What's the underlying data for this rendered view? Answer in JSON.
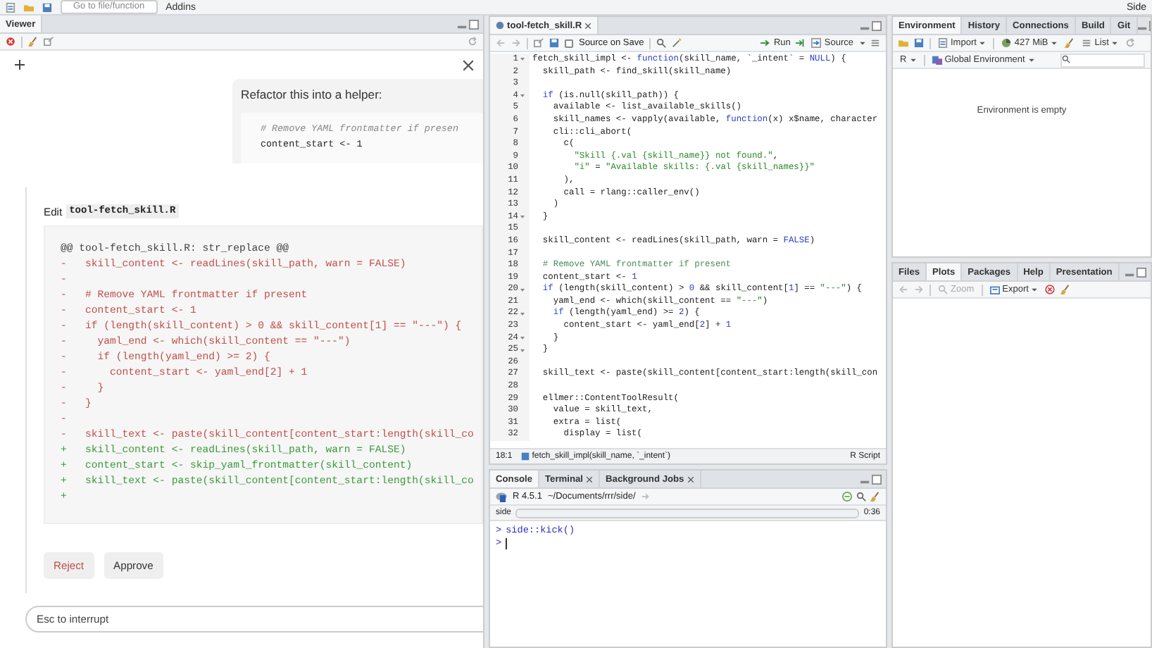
{
  "toolbar": {
    "goto_placeholder": "Go to file/function",
    "addins": "Addins",
    "project": "Side"
  },
  "viewer": {
    "tabs": [
      {
        "label": "Viewer",
        "selected": true
      }
    ],
    "prompt": {
      "title": "Refactor this into a helper:",
      "code": [
        "# Remove YAML frontmatter if presen",
        "content_start <- 1"
      ]
    },
    "edit": {
      "label": "Edit",
      "file": "tool-fetch_skill.R"
    },
    "diff": [
      {
        "kind": "header",
        "text": "@@ tool-fetch_skill.R: str_replace @@"
      },
      {
        "kind": "removed",
        "text": "-   skill_content <- readLines(skill_path, warn = FALSE)"
      },
      {
        "kind": "removed",
        "text": "-"
      },
      {
        "kind": "removed",
        "text": "-   # Remove YAML frontmatter if present"
      },
      {
        "kind": "removed",
        "text": "-   content_start <- 1"
      },
      {
        "kind": "removed",
        "text": "-   if (length(skill_content) > 0 && skill_content[1] == \"---\") {"
      },
      {
        "kind": "removed",
        "text": "-     yaml_end <- which(skill_content == \"---\")"
      },
      {
        "kind": "removed",
        "text": "-     if (length(yaml_end) >= 2) {"
      },
      {
        "kind": "removed",
        "text": "-       content_start <- yaml_end[2] + 1"
      },
      {
        "kind": "removed",
        "text": "-     }"
      },
      {
        "kind": "removed",
        "text": "-   }"
      },
      {
        "kind": "removed",
        "text": "-"
      },
      {
        "kind": "removed",
        "text": "-   skill_text <- paste(skill_content[content_start:length(skill_co"
      },
      {
        "kind": "added",
        "text": "+   skill_content <- readLines(skill_path, warn = FALSE)"
      },
      {
        "kind": "added",
        "text": "+   content_start <- skip_yaml_frontmatter(skill_content)"
      },
      {
        "kind": "added",
        "text": "+   skill_text <- paste(skill_content[content_start:length(skill_co"
      },
      {
        "kind": "added",
        "text": "+"
      }
    ],
    "buttons": [
      {
        "label": "Reject",
        "kind": "reject"
      },
      {
        "label": "Approve",
        "kind": "approve"
      }
    ],
    "input": {
      "placeholder": "Esc to interrupt"
    }
  },
  "editor": {
    "tabs": [
      {
        "label": "tool-fetch_skill.R",
        "selected": true
      }
    ],
    "source_on_save": {
      "label": "Source on Save",
      "checked": false
    },
    "run": "Run",
    "source": "Source",
    "lines": [
      {
        "n": "1",
        "fold": true,
        "parts": [
          {
            "kind": "id",
            "text": "fetch_skill_impl <- "
          },
          {
            "kind": "kw",
            "text": "function"
          },
          {
            "kind": "id",
            "text": "(skill_name, `_intent` = "
          },
          {
            "kind": "kw",
            "text": "NULL"
          },
          {
            "kind": "id",
            "text": ") {"
          }
        ]
      },
      {
        "n": "2",
        "fold": false,
        "parts": [
          {
            "kind": "id",
            "text": "  skill_path <- find_skill(skill_name)"
          }
        ]
      },
      {
        "n": "3",
        "fold": false
      },
      {
        "n": "4",
        "fold": true,
        "parts": [
          {
            "kind": "kw",
            "text": "  if"
          },
          {
            "kind": "id",
            "text": " (is.null(skill_path)) {"
          }
        ]
      },
      {
        "n": "5",
        "fold": false,
        "parts": [
          {
            "kind": "id",
            "text": "    available <- list_available_skills()"
          }
        ]
      },
      {
        "n": "6",
        "fold": false,
        "parts": [
          {
            "kind": "id",
            "text": "    skill_names <- vapply(available, "
          },
          {
            "kind": "kw",
            "text": "function"
          },
          {
            "kind": "id",
            "text": "(x) x$name, character"
          }
        ]
      },
      {
        "n": "7",
        "fold": false,
        "parts": [
          {
            "kind": "id",
            "text": "    cli::cli_abort("
          }
        ]
      },
      {
        "n": "8",
        "fold": false,
        "parts": [
          {
            "kind": "id",
            "text": "      c("
          }
        ]
      },
      {
        "n": "9",
        "fold": false,
        "parts": [
          {
            "kind": "str",
            "text": "        \"Skill {.val {skill_name}} not found.\""
          },
          {
            "kind": "id",
            "text": ","
          }
        ]
      },
      {
        "n": "10",
        "fold": false,
        "parts": [
          {
            "kind": "str",
            "text": "        \"i\""
          },
          {
            "kind": "id",
            "text": " = "
          },
          {
            "kind": "str",
            "text": "\"Available skills: {.val {skill_names}}\""
          }
        ]
      },
      {
        "n": "11",
        "fold": false,
        "parts": [
          {
            "kind": "id",
            "text": "      ),"
          }
        ]
      },
      {
        "n": "12",
        "fold": false,
        "parts": [
          {
            "kind": "id",
            "text": "      call = rlang::caller_env()"
          }
        ]
      },
      {
        "n": "13",
        "fold": false,
        "parts": [
          {
            "kind": "id",
            "text": "    )"
          }
        ]
      },
      {
        "n": "14",
        "fold": true,
        "parts": [
          {
            "kind": "id",
            "text": "  }"
          }
        ]
      },
      {
        "n": "15",
        "fold": false
      },
      {
        "n": "16",
        "fold": false,
        "parts": [
          {
            "kind": "id",
            "text": "  skill_content <- readLines(skill_path, warn = "
          },
          {
            "kind": "kw",
            "text": "FALSE"
          },
          {
            "kind": "id",
            "text": ")"
          }
        ]
      },
      {
        "n": "17",
        "fold": false
      },
      {
        "n": "18",
        "fold": false,
        "parts": [
          {
            "kind": "com",
            "text": "  # Remove YAML frontmatter if present"
          }
        ]
      },
      {
        "n": "19",
        "fold": false,
        "parts": [
          {
            "kind": "id",
            "text": "  content_start <- "
          },
          {
            "kind": "num",
            "text": "1"
          }
        ]
      },
      {
        "n": "20",
        "fold": true,
        "parts": [
          {
            "kind": "kw",
            "text": "  if"
          },
          {
            "kind": "id",
            "text": " (length(skill_content) > "
          },
          {
            "kind": "num",
            "text": "0"
          },
          {
            "kind": "id",
            "text": " && skill_content["
          },
          {
            "kind": "num",
            "text": "1"
          },
          {
            "kind": "id",
            "text": "] == "
          },
          {
            "kind": "str",
            "text": "\"---\""
          },
          {
            "kind": "id",
            "text": ") {"
          }
        ]
      },
      {
        "n": "21",
        "fold": false,
        "parts": [
          {
            "kind": "id",
            "text": "    yaml_end <- which(skill_content == "
          },
          {
            "kind": "str",
            "text": "\"---\""
          },
          {
            "kind": "id",
            "text": ")"
          }
        ]
      },
      {
        "n": "22",
        "fold": true,
        "parts": [
          {
            "kind": "kw",
            "text": "    if"
          },
          {
            "kind": "id",
            "text": " (length(yaml_end) >= "
          },
          {
            "kind": "num",
            "text": "2"
          },
          {
            "kind": "id",
            "text": ") {"
          }
        ]
      },
      {
        "n": "23",
        "fold": false,
        "parts": [
          {
            "kind": "id",
            "text": "      content_start <- yaml_end["
          },
          {
            "kind": "num",
            "text": "2"
          },
          {
            "kind": "id",
            "text": "] + "
          },
          {
            "kind": "num",
            "text": "1"
          }
        ]
      },
      {
        "n": "24",
        "fold": true,
        "parts": [
          {
            "kind": "id",
            "text": "    }"
          }
        ]
      },
      {
        "n": "25",
        "fold": true,
        "parts": [
          {
            "kind": "id",
            "text": "  }"
          }
        ]
      },
      {
        "n": "26",
        "fold": false
      },
      {
        "n": "27",
        "fold": false,
        "parts": [
          {
            "kind": "id",
            "text": "  skill_text <- paste(skill_content[content_start:length(skill_con"
          }
        ]
      },
      {
        "n": "28",
        "fold": false
      },
      {
        "n": "29",
        "fold": false,
        "parts": [
          {
            "kind": "id",
            "text": "  ellmer::ContentToolResult("
          }
        ]
      },
      {
        "n": "30",
        "fold": false,
        "parts": [
          {
            "kind": "id",
            "text": "    value = skill_text,"
          }
        ]
      },
      {
        "n": "31",
        "fold": false,
        "parts": [
          {
            "kind": "id",
            "text": "    extra = list("
          }
        ]
      },
      {
        "n": "32",
        "fold": false,
        "parts": [
          {
            "kind": "id",
            "text": "      display = list("
          }
        ]
      }
    ],
    "status": {
      "position": "18:1",
      "scope": "fetch_skill_impl(skill_name, `_intent`)",
      "filetype": "R Script"
    }
  },
  "console": {
    "tabs": [
      {
        "label": "Console",
        "selected": true,
        "closable": false
      },
      {
        "label": "Terminal",
        "selected": false,
        "closable": true
      },
      {
        "label": "Background Jobs",
        "selected": false,
        "closable": true
      }
    ],
    "version": "R 4.5.1",
    "path": "~/Documents/rrr/side/",
    "job": {
      "name": "side",
      "time": "0:36",
      "level": 1
    },
    "lines": [
      {
        "prompt": ">",
        "text": "side::kick()",
        "cursor": false
      },
      {
        "prompt": ">",
        "cursor": true
      }
    ]
  },
  "environment": {
    "tabs": [
      {
        "label": "Environment",
        "selected": true
      },
      {
        "label": "History",
        "selected": false
      },
      {
        "label": "Connections",
        "selected": false
      },
      {
        "label": "Build",
        "selected": false
      },
      {
        "label": "Git",
        "selected": false
      }
    ],
    "import": "Import",
    "memory": "427 MiB",
    "view": "List",
    "language": "R",
    "scope": "Global Environment",
    "message": "Environment is empty"
  },
  "files": {
    "tabs": [
      {
        "label": "Files",
        "selected": false
      },
      {
        "label": "Plots",
        "selected": true
      },
      {
        "label": "Packages",
        "selected": false
      },
      {
        "label": "Help",
        "selected": false
      },
      {
        "label": "Presentation",
        "selected": false
      }
    ],
    "zoom": "Zoom",
    "export": "Export"
  }
}
